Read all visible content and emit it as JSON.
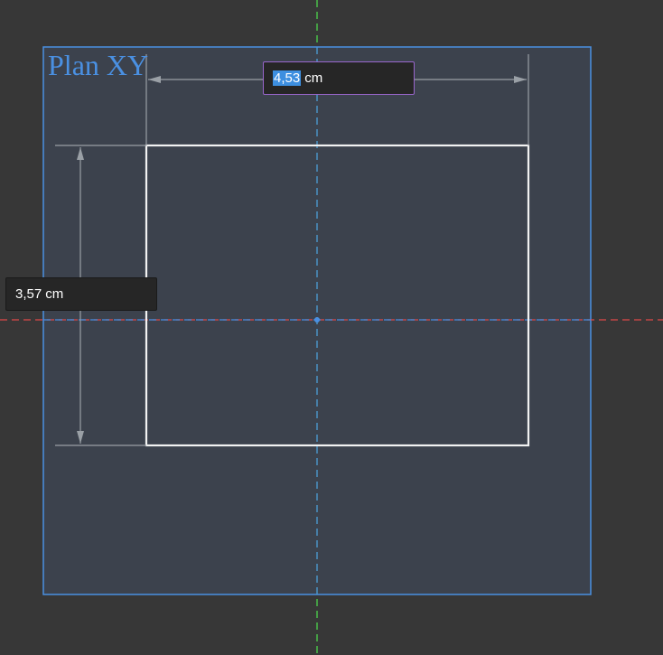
{
  "sketch": {
    "plane_label": "Plan XY"
  },
  "dimensions": {
    "width": {
      "value": "4,53",
      "unit": "cm"
    },
    "height": {
      "value": "3,57",
      "unit": "cm"
    }
  },
  "colors": {
    "background": "#373737",
    "plane_fill": "#3c424d",
    "plane_border": "#4a90e2",
    "x_axis": "#e04a4a",
    "y_axis": "#4ee04e",
    "profile": "#f2f2f2",
    "dimension_lines": "#9aa0a6",
    "active_input_border": "#9966cc",
    "selection": "#3d8fe0"
  }
}
